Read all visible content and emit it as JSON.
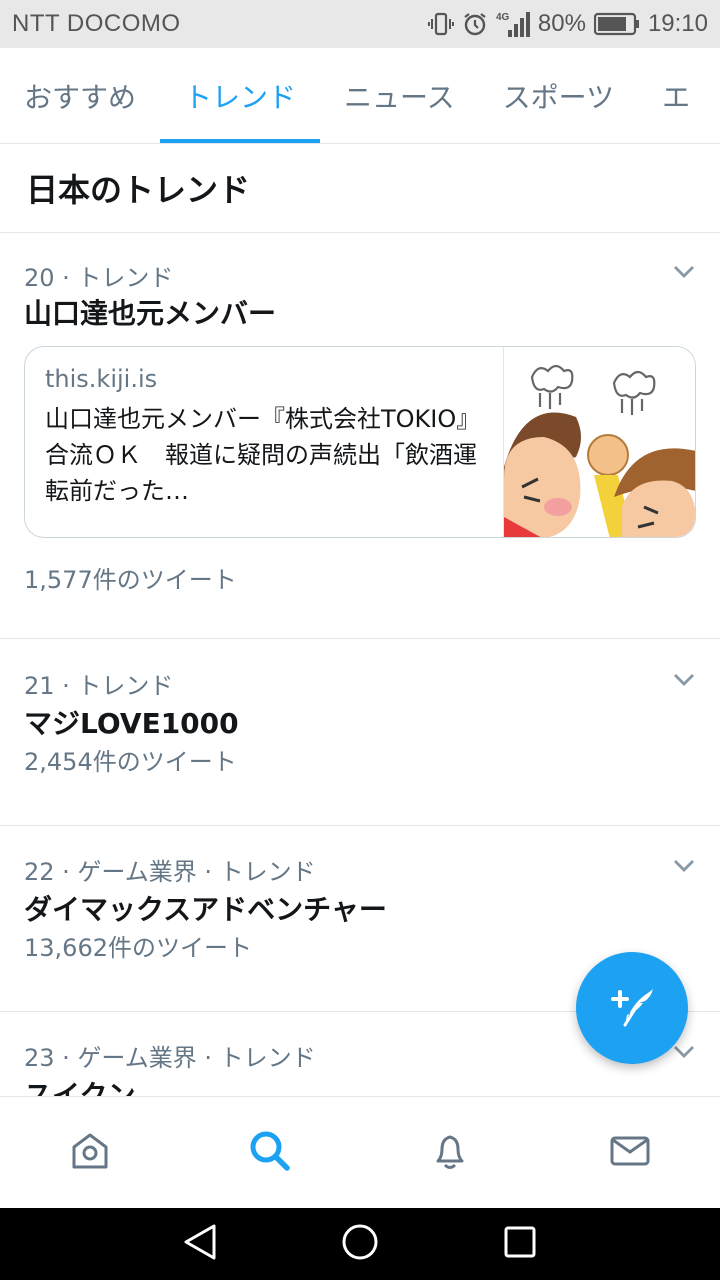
{
  "status_bar": {
    "carrier": "NTT DOCOMO",
    "network": "4G",
    "battery": "80%",
    "time": "19:10"
  },
  "tabs": [
    {
      "label": "おすすめ",
      "active": false
    },
    {
      "label": "トレンド",
      "active": true
    },
    {
      "label": "ニュース",
      "active": false
    },
    {
      "label": "スポーツ",
      "active": false
    },
    {
      "label": "エ",
      "active": false
    }
  ],
  "section_title": "日本のトレンド",
  "trends": [
    {
      "meta": "20 · トレンド",
      "name": "山口達也元メンバー",
      "card": {
        "domain": "this.kiji.is",
        "text": "山口達也元メンバー『株式会社TOKIO』合流ＯＫ　報道に疑問の声続出「飲酒運転前だった…"
      },
      "count": "1,577件のツイート"
    },
    {
      "meta": "21 · トレンド",
      "name": "マジLOVE1000",
      "count": "2,454件のツイート"
    },
    {
      "meta": "22 · ゲーム業界 · トレンド",
      "name": "ダイマックスアドベンチャー",
      "count": "13,662件のツイート"
    },
    {
      "meta": "23 · ゲーム業界 · トレンド",
      "name": "スイクン"
    }
  ],
  "colors": {
    "accent": "#1da1f2",
    "secondary_text": "#657786",
    "divider": "#e1e8ed"
  },
  "icons": {
    "fab": "compose-tweet-icon",
    "nav": [
      "home-icon",
      "search-icon",
      "bell-icon",
      "mail-icon"
    ],
    "android": [
      "back-icon",
      "home-circle-icon",
      "recents-icon"
    ]
  }
}
